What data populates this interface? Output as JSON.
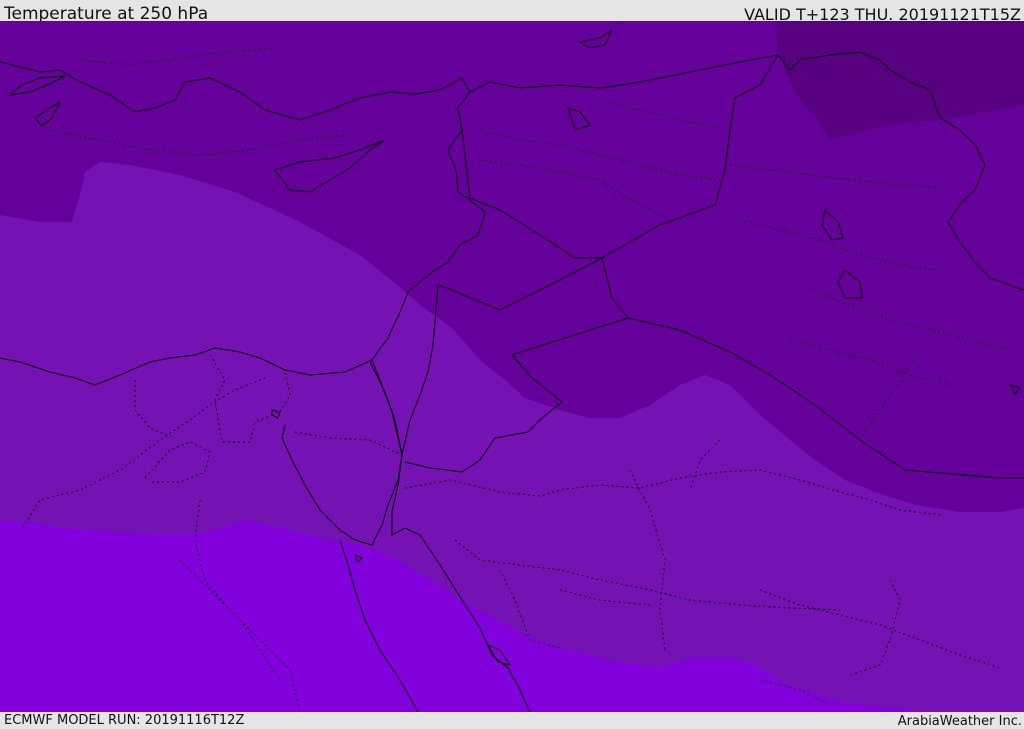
{
  "header": {
    "title": "Temperature at 250 hPa",
    "valid_time": "VALID T+123 THU. 20191121T15Z"
  },
  "footer": {
    "model_run": "ECMWF MODEL RUN: 20191116T12Z",
    "credit": "ArabiaWeather Inc."
  },
  "map": {
    "region": "Eastern Mediterranean, Egypt, Levant and Iraq",
    "temperature_bands": [
      {
        "band": "coldest",
        "color": "#570080"
      },
      {
        "band": "cold",
        "color": "#66009a"
      },
      {
        "band": "mid",
        "color": "#7512b4"
      },
      {
        "band": "warmest",
        "color": "#8100dc"
      }
    ],
    "border_color": "#000000",
    "coastline_style": "solid",
    "internal_boundary_style": "dotted"
  }
}
